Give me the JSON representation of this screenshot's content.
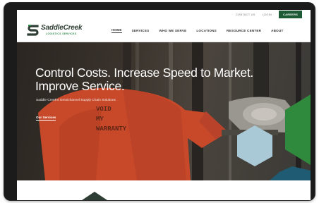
{
  "utility_bar": {
    "links": [
      "CONTACT US",
      "LOGIN"
    ],
    "careers_label": "CAREERS"
  },
  "logo": {
    "name": "SaddleCreek",
    "tagline": "LOGISTICS SERVICES"
  },
  "nav": {
    "items": [
      "HOME",
      "SERVICES",
      "WHO WE SERVE",
      "LOCATIONS",
      "RESOURCE CENTER",
      "ABOUT"
    ],
    "active_index": 0
  },
  "hero": {
    "title": "Control Costs. Increase Speed to Market. Improve Service.",
    "subtitle": "Saddle Creek's Omnichannel Supply Chain Solutions",
    "cta_label": "Our Services",
    "shirt_text": [
      "VOID",
      "MY",
      "WARRANTY"
    ]
  },
  "colors": {
    "brand_green": "#1e5a35",
    "accent_green": "#2f8a3e",
    "hex_light": "#a9c9d6",
    "hex_teal": "#1f5b73",
    "safety_orange": "#d8562c"
  }
}
